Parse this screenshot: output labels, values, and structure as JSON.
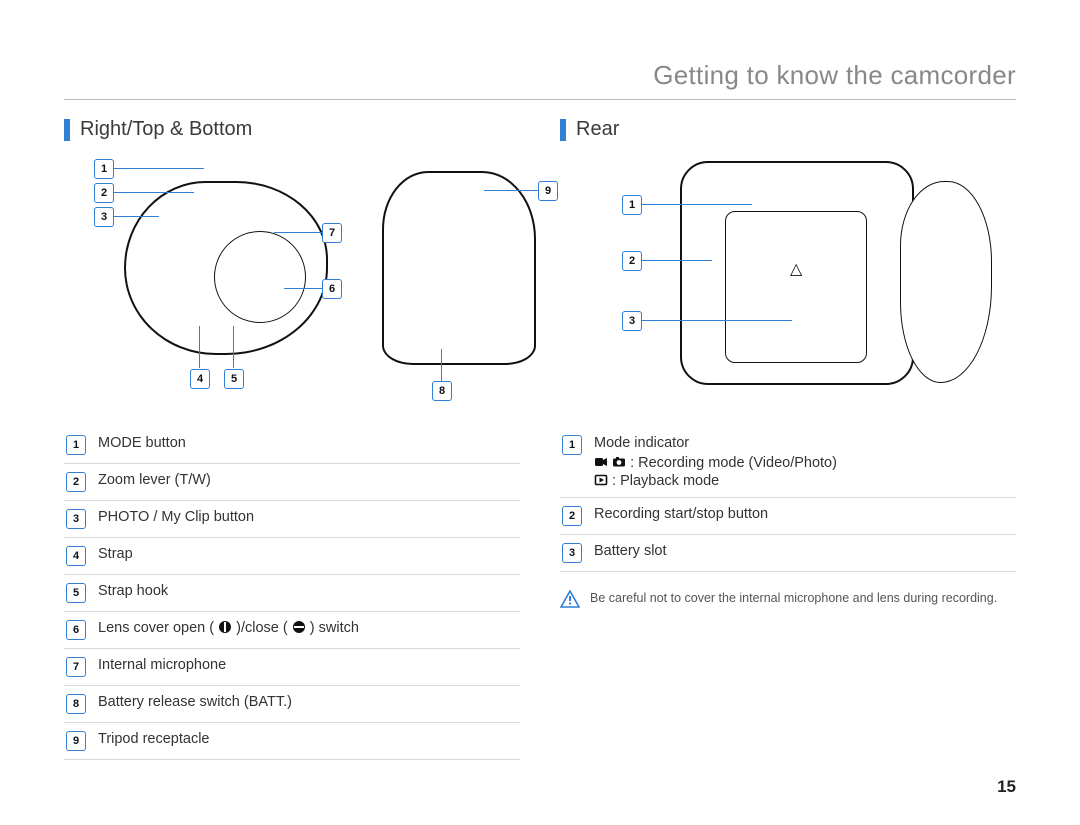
{
  "page": {
    "title": "Getting to know the camcorder",
    "number": "15"
  },
  "left": {
    "heading": "Right/Top & Bottom",
    "callouts": [
      "1",
      "2",
      "3",
      "4",
      "5",
      "6",
      "7",
      "8",
      "9"
    ],
    "legend": [
      {
        "n": "1",
        "text": "MODE button"
      },
      {
        "n": "2",
        "text": "Zoom lever (T/W)"
      },
      {
        "n": "3",
        "text": "PHOTO / My Clip button"
      },
      {
        "n": "4",
        "text": "Strap"
      },
      {
        "n": "5",
        "text": "Strap hook"
      },
      {
        "n": "6",
        "text_pre": "Lens cover open (",
        "text_mid": ")/close (",
        "text_post": ") switch"
      },
      {
        "n": "7",
        "text": "Internal microphone"
      },
      {
        "n": "8",
        "text": "Battery release switch (BATT.)"
      },
      {
        "n": "9",
        "text": "Tripod receptacle"
      }
    ]
  },
  "right": {
    "heading": "Rear",
    "callouts": [
      "1",
      "2",
      "3"
    ],
    "legend": [
      {
        "n": "1",
        "line1": "Mode indicator",
        "line2": ": Recording mode (Video/Photo)",
        "line3": ": Playback mode"
      },
      {
        "n": "2",
        "text": "Recording start/stop button"
      },
      {
        "n": "3",
        "text": "Battery slot"
      }
    ],
    "note": "Be careful not to cover the internal microphone and lens during recording."
  }
}
